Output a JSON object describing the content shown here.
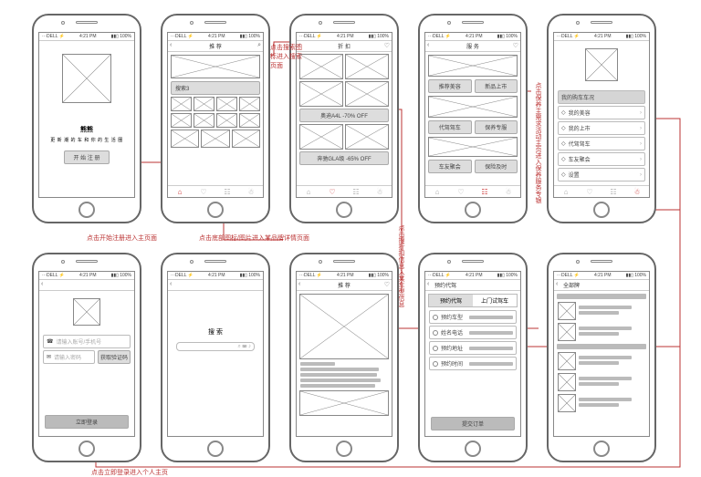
{
  "status": {
    "left": "···DELL ⚡",
    "center": "4:21 PM",
    "right": "▮▮▯ 100%"
  },
  "p1": {
    "brand": "熊熊",
    "slogan": "更 新 潮 的 车 和 你 的 生 活 圈",
    "start_btn": "开 始 注 册"
  },
  "p2": {
    "title": "推 荐",
    "searchbar": "搜索3"
  },
  "p3": {
    "title": "折 扣",
    "promo1": "奥迪A4L -70% OFF",
    "promo2": "奔驰GLA级 -65% OFF"
  },
  "p4": {
    "title": "服 务",
    "svc1a": "推荐美容",
    "svc1b": "新品上市",
    "svc2a": "代驾驾车",
    "svc2b": "保养专服",
    "svc3a": "车友聚会",
    "svc3b": "保险及时"
  },
  "p5": {
    "mine_title": "我的购车车况",
    "m1": "我的美容",
    "m2": "我的上市",
    "m3": "代驾驾车",
    "m4": "车友聚会",
    "m5": "设置"
  },
  "p6": {
    "input1_ph": "请输入账号/手机号",
    "input2_ph": "请输入密码",
    "getcode": "获取验证码",
    "login_btn": "立即登录"
  },
  "p7": {
    "title": "搜 索",
    "input_hint": "⌕  ⌨  ♪"
  },
  "p8": {
    "title": "推 荐"
  },
  "p9": {
    "back": "预约代驾",
    "tab_a": "预约代驾",
    "tab_b": "上门试驾车",
    "r1": "预约车型",
    "r2": "姓名电话",
    "r3": "预约地址",
    "r4": "预约时间",
    "submit": "提交订单"
  },
  "p10": {
    "back": "全部牌"
  },
  "ann": {
    "a1": "点击开始注册进入主页面",
    "a2": "点击底部图标/图片进入某品牌详情页面",
    "a3": "点击搜索图标进入搜索页面",
    "a4": "点击搜折扣信息入某车型信息",
    "a5": "点击保养主需求活动主页进入保养服务专银",
    "a6": "点击立即登录进入个人主页"
  }
}
